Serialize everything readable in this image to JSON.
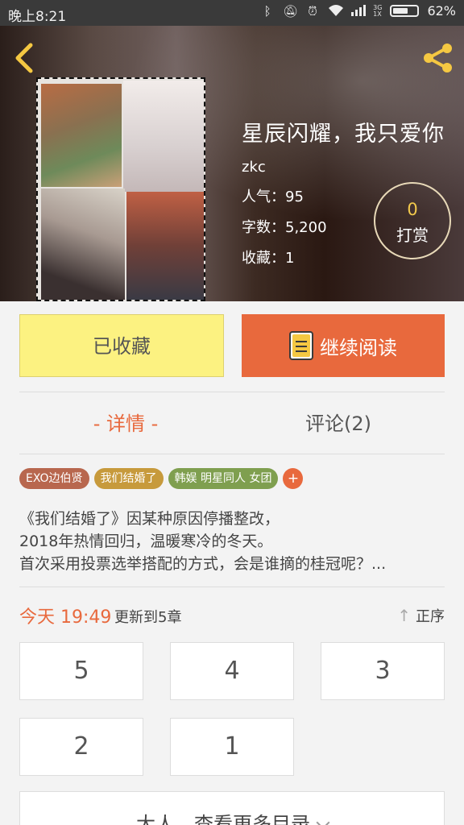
{
  "status_bar": {
    "time": "晚上8:21",
    "network_top": "3G",
    "network_bottom": "1X",
    "battery": "62%",
    "battery_level": 0.62
  },
  "header": {
    "back_icon": "chevron-left-icon",
    "share_icon": "share-icon"
  },
  "book": {
    "title": "星辰闪耀，我只爱你",
    "author": "zkc",
    "popularity": "人气：95",
    "word_count": "字数：5,200",
    "favorites": "收藏：1",
    "tip_count": "0",
    "tip_label": "打赏"
  },
  "actions": {
    "collected_label": "已收藏",
    "continue_label": "继续阅读"
  },
  "tabs": {
    "details": "- 详情 -",
    "comments": "评论(2)"
  },
  "tags": [
    {
      "label": "EXO边伯贤",
      "color": "#b8674e"
    },
    {
      "label": "我们结婚了",
      "color": "#c79a3c"
    },
    {
      "label": "韩娱 明星同人 女团",
      "color": "#7f9f4f"
    },
    {
      "label": "+",
      "color": "#e8693d"
    }
  ],
  "description": {
    "line1": "《我们结婚了》因某种原因停播整改，",
    "line2": "2018年热情回归，温暖寒冷的冬天。",
    "line3": "首次采用投票选举搭配的方式，会是谁摘的桂冠呢？..."
  },
  "updates": {
    "time": "今天 19:49",
    "info": "更新到5章",
    "sort_label": "正序"
  },
  "chapters": [
    "5",
    "4",
    "3",
    "2",
    "1"
  ],
  "more": {
    "label": "大人，查看更多目录"
  },
  "colors": {
    "accent": "#e8693d",
    "collected_bg": "#fcf281"
  }
}
